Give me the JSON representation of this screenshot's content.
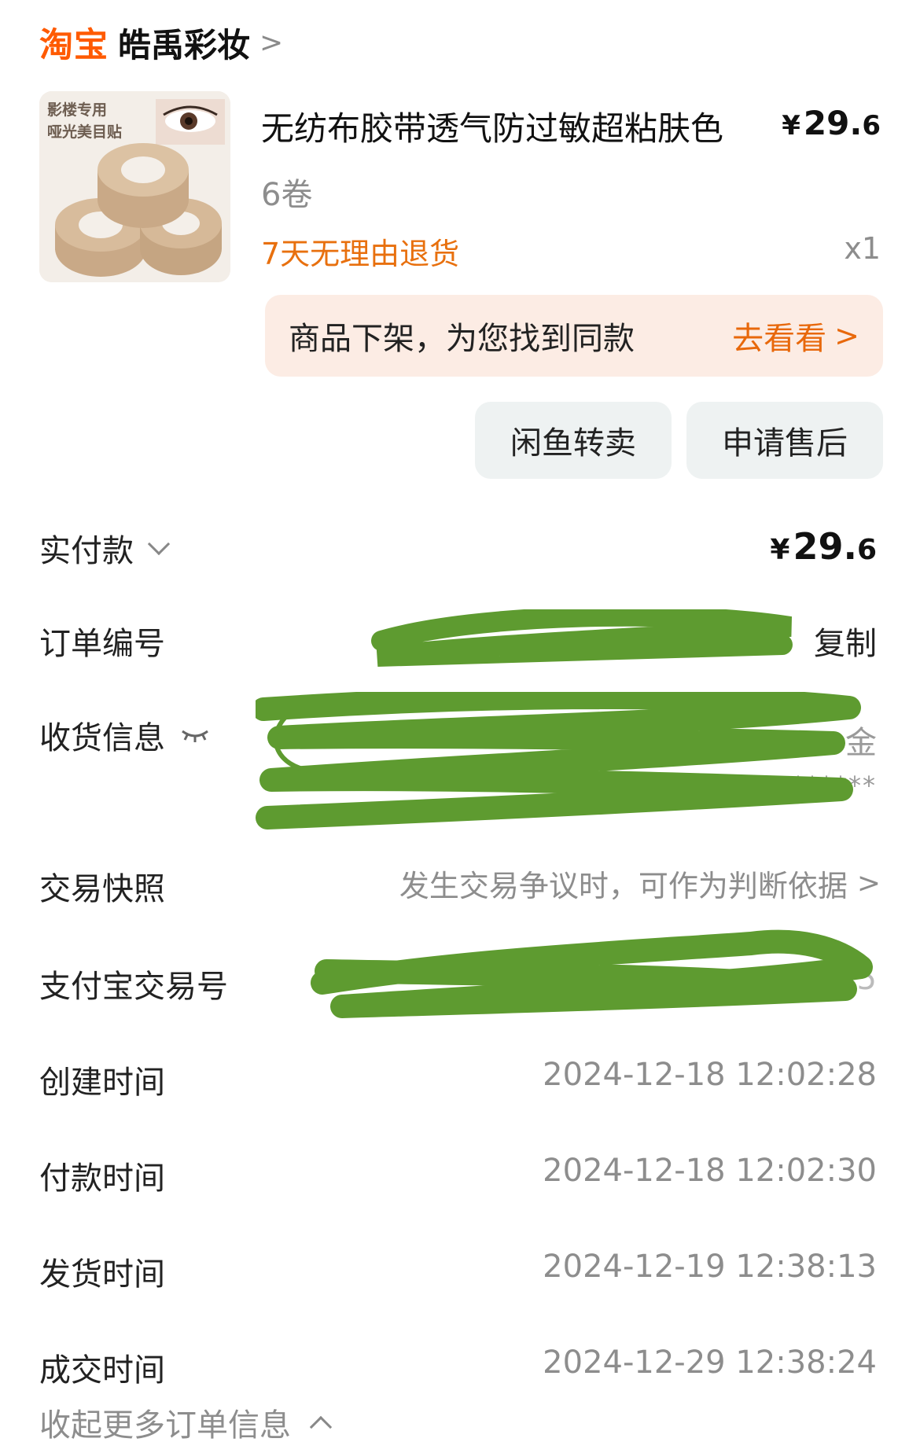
{
  "shop": {
    "platform": "淘宝",
    "name": "皓禹彩妆",
    "chevron": ">"
  },
  "product": {
    "thumbnail_text_1": "影楼专用",
    "thumbnail_text_2": "哑光美目贴",
    "title": "无纺布胶带透气防过敏超粘肤色",
    "price_symbol": "¥",
    "price_int": "29.",
    "price_dec": "6",
    "spec": "6卷",
    "return_policy": "7天无理由退货",
    "quantity": "x1"
  },
  "banner": {
    "text": "商品下架，为您找到同款",
    "link": "去看看",
    "chevron": ">"
  },
  "buttons": {
    "resell": "闲鱼转卖",
    "after_sales": "申请售后"
  },
  "info": {
    "paid_label": "实付款",
    "paid_symbol": "¥",
    "paid_int": "29.",
    "paid_dec": "6",
    "order_no_label": "订单编号",
    "copy_label": "复制",
    "shipping_label": "收货信息",
    "shipping_addr_tail": "金",
    "shipping_phone_tail": "******",
    "snapshot_label": "交易快照",
    "snapshot_value": "发生交易争议时，可作为判断依据",
    "snapshot_chevron": ">",
    "alipay_label": "支付宝交易号",
    "alipay_tail": "5",
    "created_label": "创建时间",
    "created_value": "2024-12-18 12:02:28",
    "paid_time_label": "付款时间",
    "paid_time_value": "2024-12-18 12:02:30",
    "shipped_label": "发货时间",
    "shipped_value": "2024-12-19 12:38:13",
    "completed_label": "成交时间",
    "completed_value": "2024-12-29 12:38:24",
    "collapse_label": "收起更多订单信息"
  },
  "colors": {
    "accent_orange": "#ff5a00",
    "redaction_green": "#5e9b30"
  }
}
